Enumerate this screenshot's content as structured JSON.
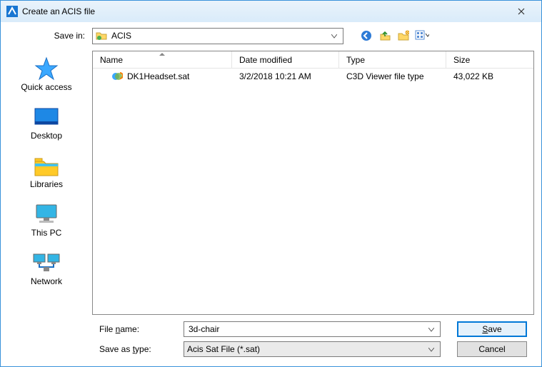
{
  "window": {
    "title": "Create an ACIS file"
  },
  "saveIn": {
    "label": "Save in:",
    "value": "ACIS"
  },
  "columns": {
    "name": "Name",
    "date": "Date modified",
    "type": "Type",
    "size": "Size"
  },
  "files": [
    {
      "name": "DK1Headset.sat",
      "date": "3/2/2018 10:21 AM",
      "type": "C3D Viewer file type",
      "size": "43,022 KB"
    }
  ],
  "places": {
    "quick": "Quick access",
    "desktop": "Desktop",
    "libraries": "Libraries",
    "thispc": "This PC",
    "network": "Network"
  },
  "bottom": {
    "fileNameLabel": "File name:",
    "fileNameValue": "3d-chair",
    "saveTypeLabel": "Save as type:",
    "saveTypeValue": "Acis Sat File (*.sat)",
    "saveBtn": "Save",
    "cancelBtn": "Cancel"
  }
}
